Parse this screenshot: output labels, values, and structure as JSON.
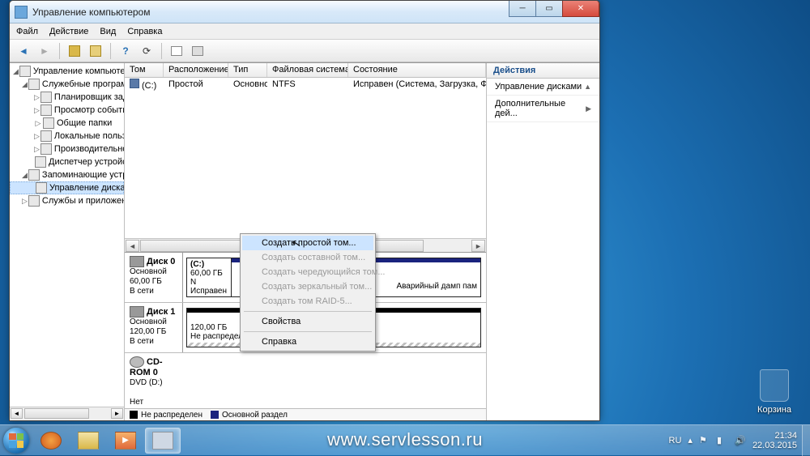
{
  "window": {
    "title": "Управление компьютером"
  },
  "menubar": [
    "Файл",
    "Действие",
    "Вид",
    "Справка"
  ],
  "tree": {
    "root": "Управление компьютером (л",
    "g1": "Служебные программы",
    "g1_items": [
      "Планировщик заданий",
      "Просмотр событий",
      "Общие папки",
      "Локальные пользоват",
      "Производительность",
      "Диспетчер устройств"
    ],
    "g2": "Запоминающие устрой",
    "g2_items": [
      "Управление дисками"
    ],
    "g3": "Службы и приложения"
  },
  "grid": {
    "cols": [
      "Том",
      "Расположение",
      "Тип",
      "Файловая система",
      "Состояние"
    ],
    "row": {
      "vol": "(C:)",
      "layout": "Простой",
      "type": "Основной",
      "fs": "NTFS",
      "state": "Исправен (Система, Загрузка, Файл подкачки, А"
    }
  },
  "disks": {
    "d0": {
      "name": "Диск 0",
      "type": "Основной",
      "size": "60,00 ГБ",
      "status": "В сети",
      "vol": {
        "label": "(C:)",
        "size": "60,00 ГБ N",
        "state": "Исправен"
      },
      "vol2": {
        "state": "Аварийный дамп пам"
      }
    },
    "d1": {
      "name": "Диск 1",
      "type": "Основной",
      "size": "120,00 ГБ",
      "status": "В сети",
      "vol": {
        "size": "120,00 ГБ",
        "state": "Не распределен"
      }
    },
    "cd": {
      "name": "CD-ROM 0",
      "type": "DVD (D:)",
      "status": "Нет носителя"
    }
  },
  "legend": {
    "unalloc": "Не распределен",
    "primary": "Основной раздел"
  },
  "actions": {
    "header": "Действия",
    "item1": "Управление дисками",
    "item2": "Дополнительные дей..."
  },
  "context": {
    "i1": "Создать простой том...",
    "i2": "Создать составной том...",
    "i3": "Создать чередующийся том...",
    "i4": "Создать зеркальный том...",
    "i5": "Создать том RAID-5...",
    "i6": "Свойства",
    "i7": "Справка"
  },
  "desktop": {
    "trash": "Корзина"
  },
  "taskbar": {
    "lang": "RU",
    "time": "21:34",
    "date": "22.03.2015",
    "watermark": "www.servlesson.ru"
  }
}
